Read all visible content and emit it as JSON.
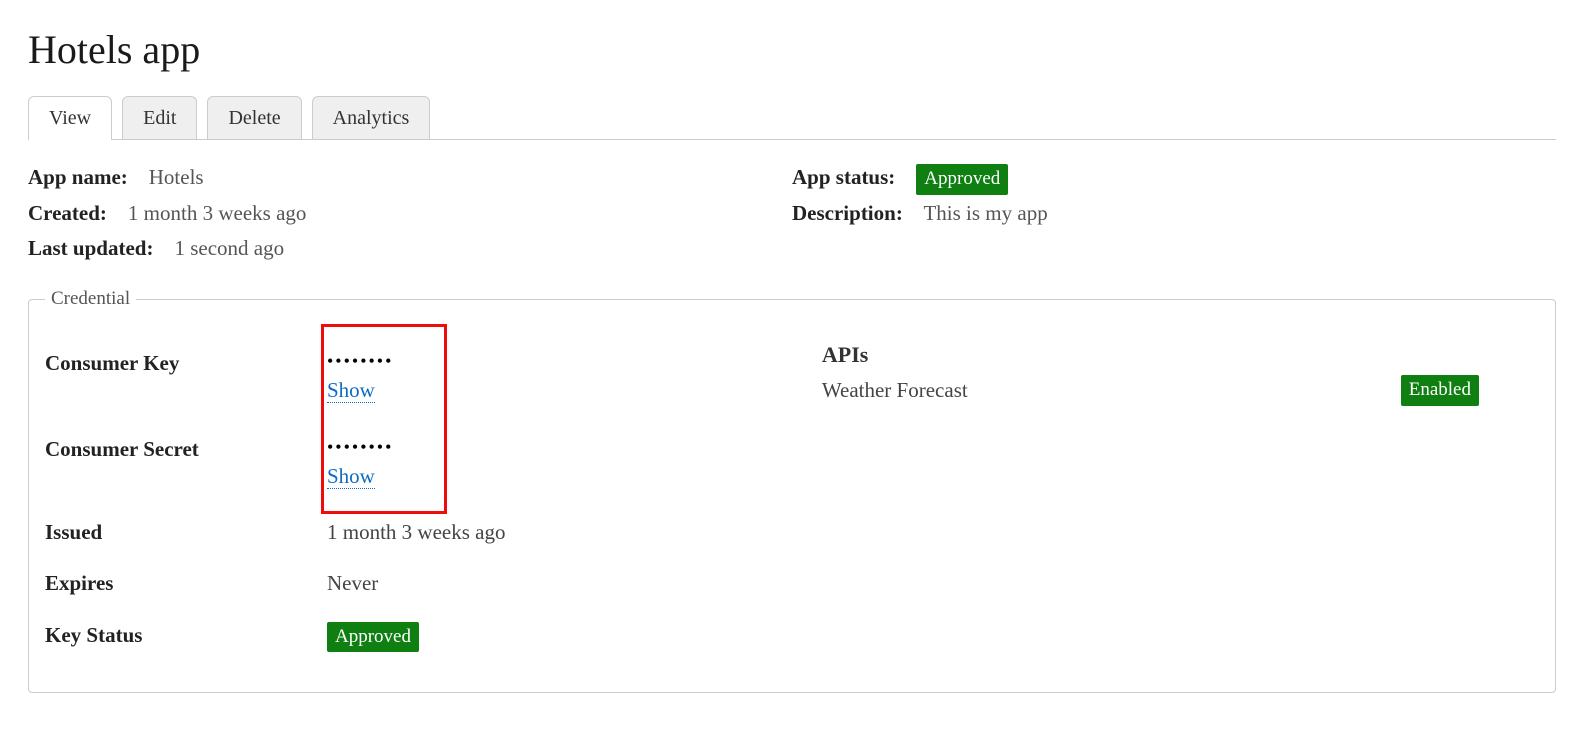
{
  "page_title": "Hotels app",
  "tabs": [
    {
      "label": "View",
      "active": true
    },
    {
      "label": "Edit",
      "active": false
    },
    {
      "label": "Delete",
      "active": false
    },
    {
      "label": "Analytics",
      "active": false
    }
  ],
  "meta": {
    "app_name_label": "App name:",
    "app_name": "Hotels",
    "created_label": "Created:",
    "created": "1 month 3 weeks ago",
    "last_updated_label": "Last updated:",
    "last_updated": "1 second ago",
    "app_status_label": "App status:",
    "app_status": "Approved",
    "description_label": "Description:",
    "description": "This is my app"
  },
  "credential": {
    "legend": "Credential",
    "consumer_key_label": "Consumer Key",
    "consumer_key_masked": "••••••••",
    "consumer_key_show": "Show",
    "consumer_secret_label": "Consumer Secret",
    "consumer_secret_masked": "••••••••",
    "consumer_secret_show": "Show",
    "issued_label": "Issued",
    "issued": "1 month 3 weeks ago",
    "expires_label": "Expires",
    "expires": "Never",
    "key_status_label": "Key Status",
    "key_status": "Approved",
    "apis_label": "APIs",
    "apis": [
      {
        "name": "Weather Forecast",
        "status": "Enabled"
      }
    ]
  }
}
